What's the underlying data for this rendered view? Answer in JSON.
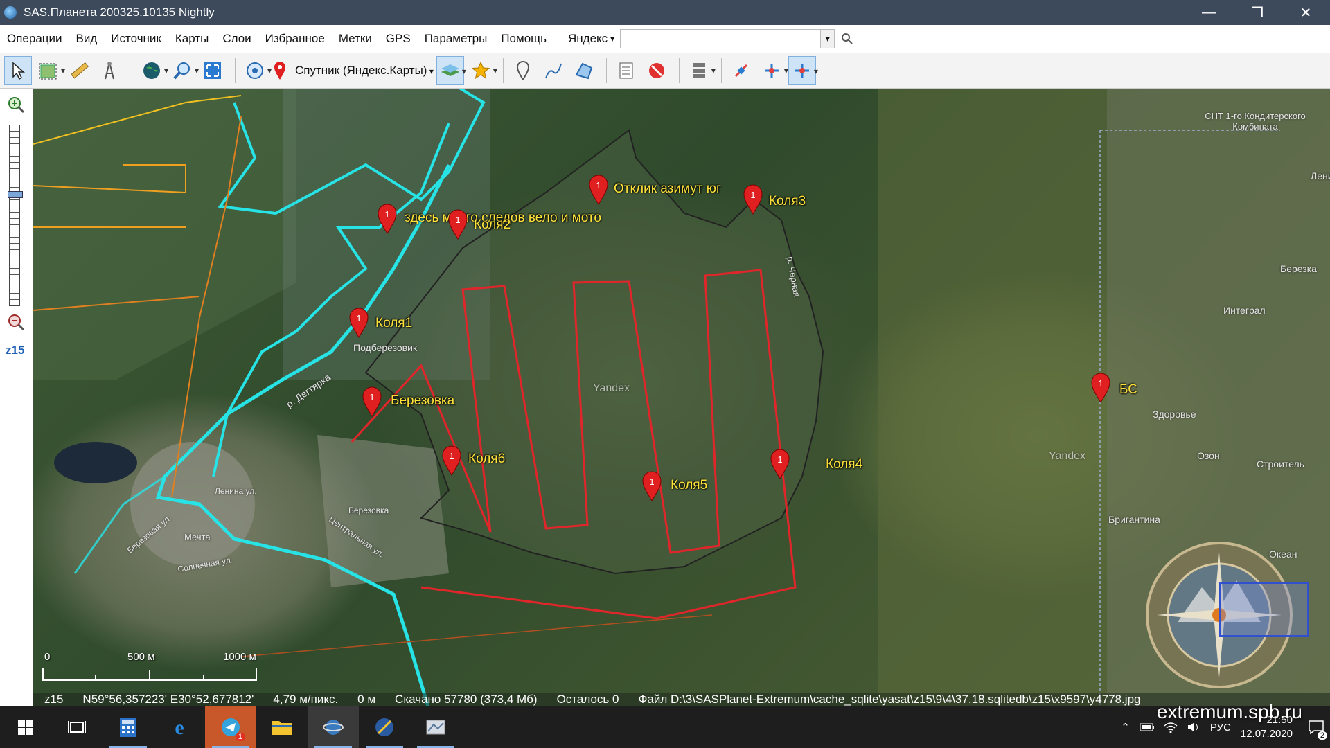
{
  "window": {
    "title": "SAS.Планета 200325.10135 Nightly",
    "controls": [
      "minimize",
      "restore",
      "close"
    ]
  },
  "menu": {
    "items": [
      "Операции",
      "Вид",
      "Источник",
      "Карты",
      "Слои",
      "Избранное",
      "Метки",
      "GPS",
      "Параметры",
      "Помощь"
    ],
    "search_provider": "Яндекс",
    "search_value": ""
  },
  "toolbar": {
    "map_type": "Спутник (Яндекс.Карты)",
    "icons": [
      "pointer-icon",
      "select-area-icon",
      "ruler-icon",
      "compass-icon",
      "globe-icon",
      "zoom-icon",
      "fullscreen-icon",
      "gps-icon",
      "marker-icon",
      "layers-icon",
      "favorites-star-icon",
      "add-point-icon",
      "add-path-icon",
      "add-polygon-icon",
      "marks-list-icon",
      "hide-marks-icon",
      "tile-storage-icon",
      "satellite-icon",
      "satellite2-icon",
      "satellite3-icon"
    ]
  },
  "left_panel": {
    "zoom_level": "z15"
  },
  "map": {
    "marks": [
      {
        "label": "Отклик азимут юг"
      },
      {
        "label": "Коля3"
      },
      {
        "label": "здесь много следов вело и мото"
      },
      {
        "label": "Коля2"
      },
      {
        "label": "Коля1"
      },
      {
        "label": "Березовка"
      },
      {
        "label": "Коля6"
      },
      {
        "label": "Коля5"
      },
      {
        "label": "Коля4"
      },
      {
        "label": "БС"
      }
    ],
    "place_labels": [
      "Подберезовик",
      "р. Дегтярка",
      "Березовка",
      "Центральная ул.",
      "Березовая ул.",
      "Солнечная ул.",
      "Ленина ул.",
      "Мечта",
      "р. Черная",
      "Yandex",
      "Yandex",
      "Бригантина",
      "Здоровье",
      "Интеграл",
      "Березка",
      "СНТ 1-го Кондитерского Комбината",
      "Ленин",
      "Озон",
      "Строитель",
      "Океан"
    ],
    "scale": {
      "labels": [
        "0",
        "500 м",
        "1000 м"
      ]
    }
  },
  "status": {
    "zoom": "z15",
    "coords": "N59°56,357223' E30°52,677812'",
    "resolution": "4,79 м/пикс.",
    "altitude": "0 м",
    "downloaded": "Скачано 57780 (373,4 Мб)",
    "remaining": "Осталось 0",
    "file": "Файл D:\\3\\SASPlanet-Extremum\\cache_sqlite\\yasat\\z15\\9\\4\\37.18.sqlitedb\\z15\\x9597\\y4778.jpg"
  },
  "taskbar": {
    "language": "РУС",
    "time": "21:50",
    "date": "12.07.2020",
    "notification_count": "2",
    "telegram_badge": "1"
  },
  "watermark": "extremum.spb.ru",
  "colors": {
    "track_cyan": "#27e3e6",
    "route_red": "#e0262a",
    "mark_label": "#ffe23a"
  }
}
